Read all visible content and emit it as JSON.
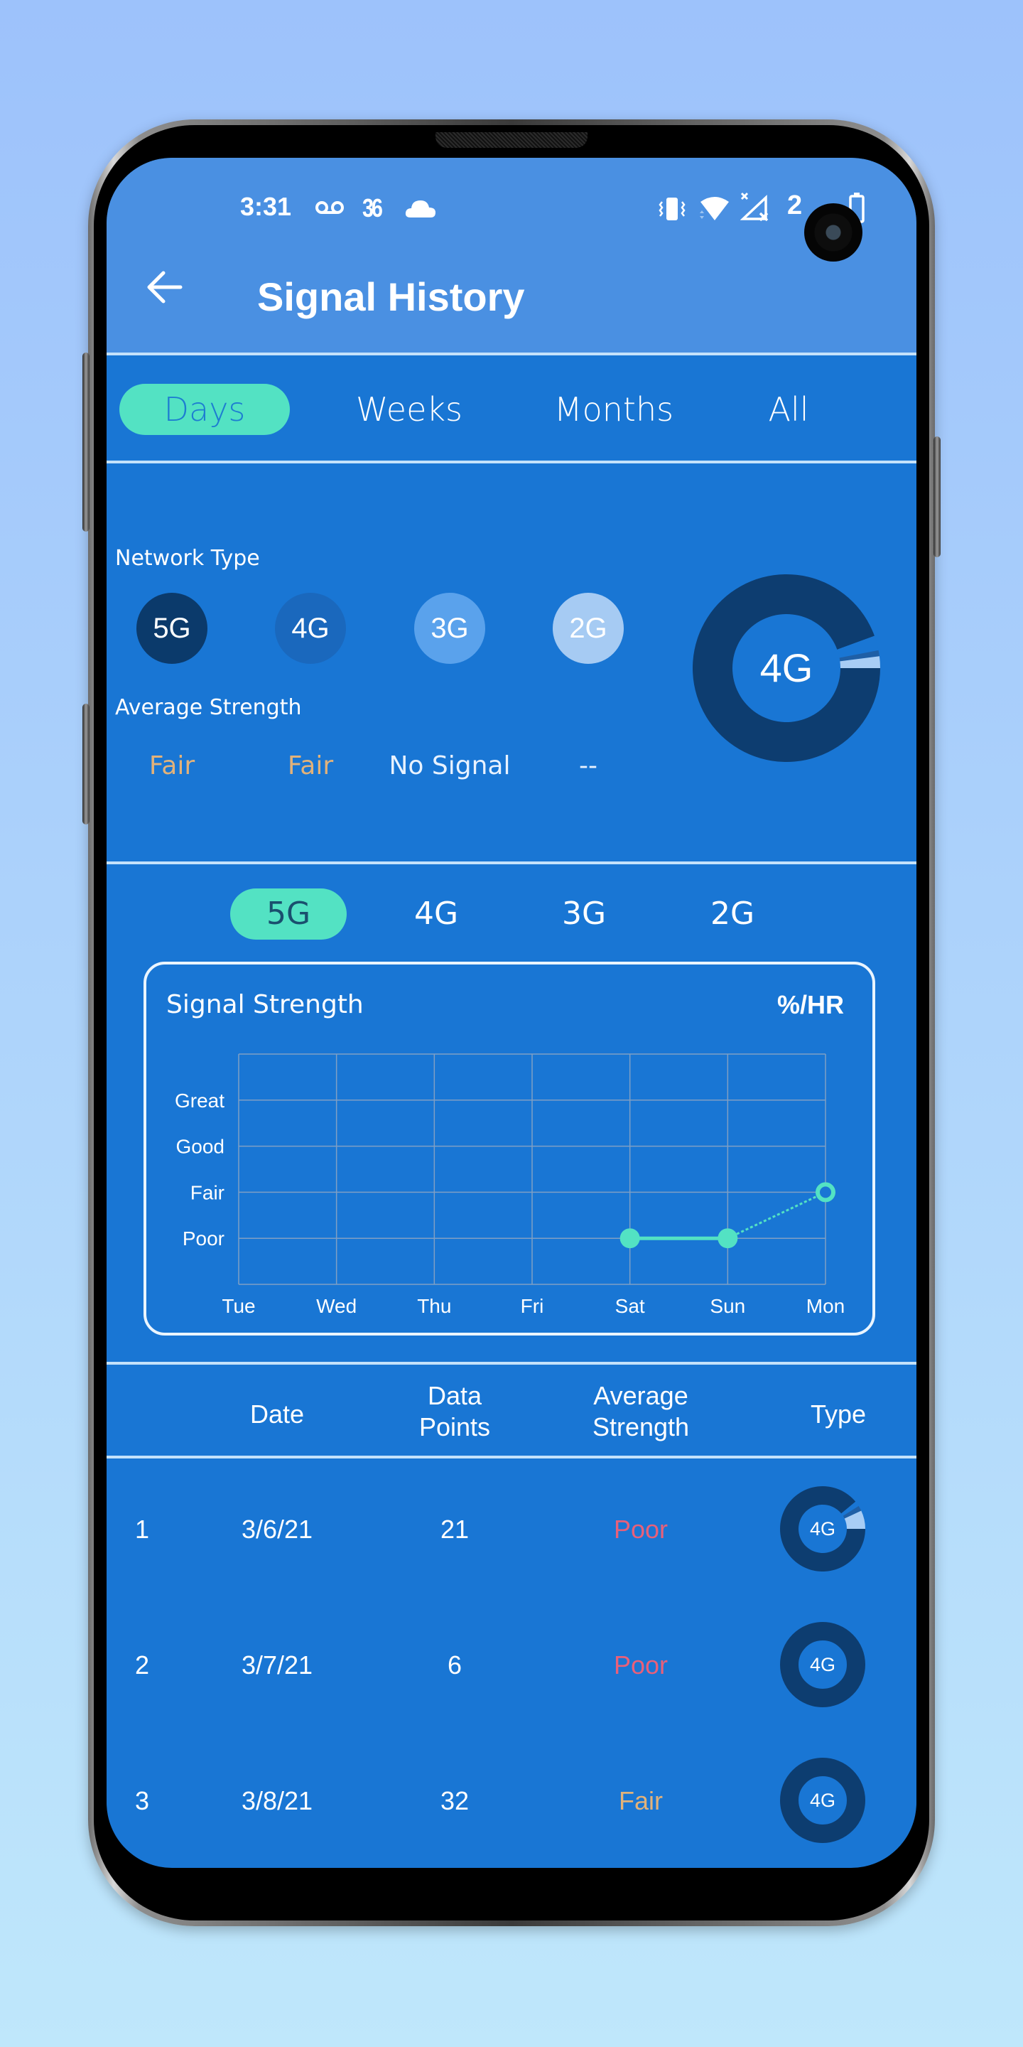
{
  "status_bar": {
    "time": "3:31",
    "left_icons": [
      "voicemail-icon",
      "temperature-36-icon",
      "cloud-icon"
    ],
    "right_icons": [
      "vibrate-icon",
      "wifi-icon",
      "signal-no-service-icon"
    ],
    "battery_text": "2",
    "temp_text": "36"
  },
  "header": {
    "title": "Signal History",
    "back_icon": "arrow-left-icon"
  },
  "period_tabs": [
    {
      "label": "Days",
      "active": true
    },
    {
      "label": "Weeks",
      "active": false
    },
    {
      "label": "Months",
      "active": false
    },
    {
      "label": "All",
      "active": false
    }
  ],
  "network_summary": {
    "network_type_label": "Network Type",
    "average_strength_label": "Average Strength",
    "types": [
      {
        "label": "5G",
        "color": "#0b3a6b",
        "strength": "Fair",
        "strength_color": "#e2b27a"
      },
      {
        "label": "4G",
        "color": "#1a68bd",
        "strength": "Fair",
        "strength_color": "#e2b27a"
      },
      {
        "label": "3G",
        "color": "#5aa2ec",
        "strength": "No Signal",
        "strength_color": "#e8f2ff"
      },
      {
        "label": "2G",
        "color": "#a6cbf3",
        "strength": "--",
        "strength_color": "#e8f2ff"
      }
    ],
    "donut": {
      "center_label": "4G",
      "segments": [
        {
          "name": "4G",
          "fraction": 0.93,
          "color": "#0d3d70"
        },
        {
          "name": "gap",
          "fraction": 0.025,
          "color": "#1976d4"
        },
        {
          "name": "5G",
          "fraction": 0.01,
          "color": "#1f5fa6"
        },
        {
          "name": "3G",
          "fraction": 0.02,
          "color": "#a8cdf5"
        }
      ]
    }
  },
  "tech_tabs": [
    {
      "label": "5G",
      "active": true
    },
    {
      "label": "4G",
      "active": false
    },
    {
      "label": "3G",
      "active": false
    },
    {
      "label": "2G",
      "active": false
    }
  ],
  "chart_data": {
    "type": "line",
    "title": "Signal Strength",
    "unit_label": "%/HR",
    "categories": [
      "Tue",
      "Wed",
      "Thu",
      "Fri",
      "Sat",
      "Sun",
      "Mon"
    ],
    "y_levels": [
      "Poor",
      "Fair",
      "Good",
      "Great"
    ],
    "series": [
      {
        "name": "5G",
        "values": [
          null,
          null,
          null,
          null,
          1,
          1,
          2
        ],
        "value_labels": [
          null,
          null,
          null,
          null,
          "Poor",
          "Poor",
          "Fair"
        ],
        "color": "#53e2c3",
        "last_point_projected": true
      }
    ],
    "ylim": [
      0,
      5
    ],
    "grid": true,
    "xlabel": "",
    "ylabel": ""
  },
  "table": {
    "headers": [
      "",
      "Date",
      "Data\nPoints",
      "Average\nStrength",
      "Type"
    ],
    "header_lines": {
      "date": "Date",
      "points_1": "Data",
      "points_2": "Points",
      "avg_1": "Average",
      "avg_2": "Strength",
      "type": "Type"
    },
    "rows": [
      {
        "index": "1",
        "date": "3/6/21",
        "points": "21",
        "strength": "Poor",
        "strength_color": "#e8607a",
        "type": "4G",
        "donut": [
          {
            "fraction": 0.89,
            "color": "#0d3d70"
          },
          {
            "fraction": 0.02,
            "color": "#1976d4"
          },
          {
            "fraction": 0.02,
            "color": "#1f5fa6"
          },
          {
            "fraction": 0.07,
            "color": "#a8cdf5"
          }
        ]
      },
      {
        "index": "2",
        "date": "3/7/21",
        "points": "6",
        "strength": "Poor",
        "strength_color": "#e8607a",
        "type": "4G",
        "donut": [
          {
            "fraction": 1.0,
            "color": "#0d3d70"
          }
        ]
      },
      {
        "index": "3",
        "date": "3/8/21",
        "points": "32",
        "strength": "Fair",
        "strength_color": "#e2b27a",
        "type": "4G",
        "donut": [
          {
            "fraction": 1.0,
            "color": "#0d3d70"
          }
        ]
      }
    ]
  },
  "colors": {
    "app_bar": "#4a90e2",
    "content_bg": "#1976d4",
    "accent": "#53e2c3",
    "divider": "#c4e2fb",
    "poor": "#e8607a",
    "fair": "#e2b27a"
  }
}
